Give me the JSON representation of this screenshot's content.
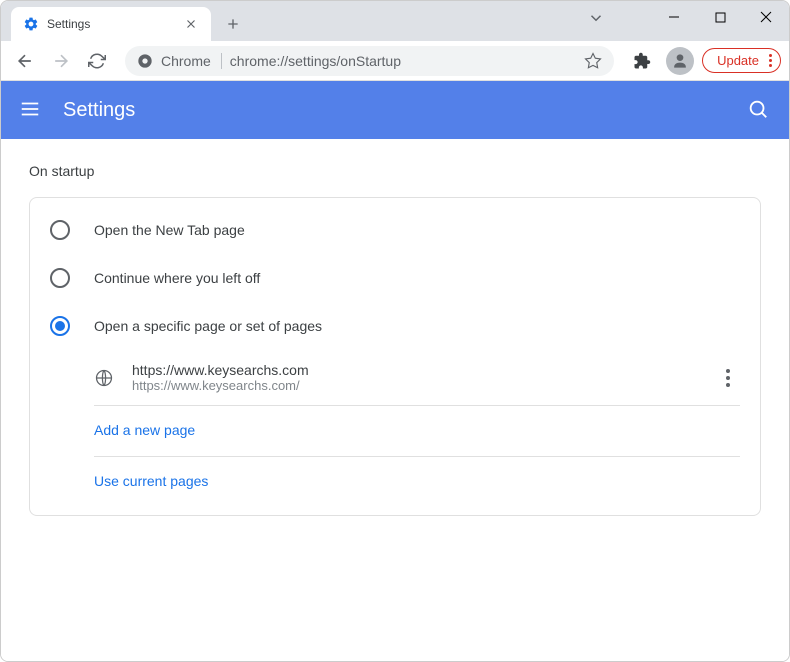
{
  "tab": {
    "title": "Settings"
  },
  "omnibox": {
    "label": "Chrome",
    "url": "chrome://settings/onStartup"
  },
  "toolbar": {
    "update_label": "Update"
  },
  "header": {
    "title": "Settings"
  },
  "section": {
    "title": "On startup"
  },
  "options": [
    {
      "label": "Open the New Tab page",
      "checked": false
    },
    {
      "label": "Continue where you left off",
      "checked": false
    },
    {
      "label": "Open a specific page or set of pages",
      "checked": true
    }
  ],
  "pages": [
    {
      "title": "https://www.keysearchs.com",
      "url": "https://www.keysearchs.com/"
    }
  ],
  "actions": {
    "add_page": "Add a new page",
    "use_current": "Use current pages"
  }
}
